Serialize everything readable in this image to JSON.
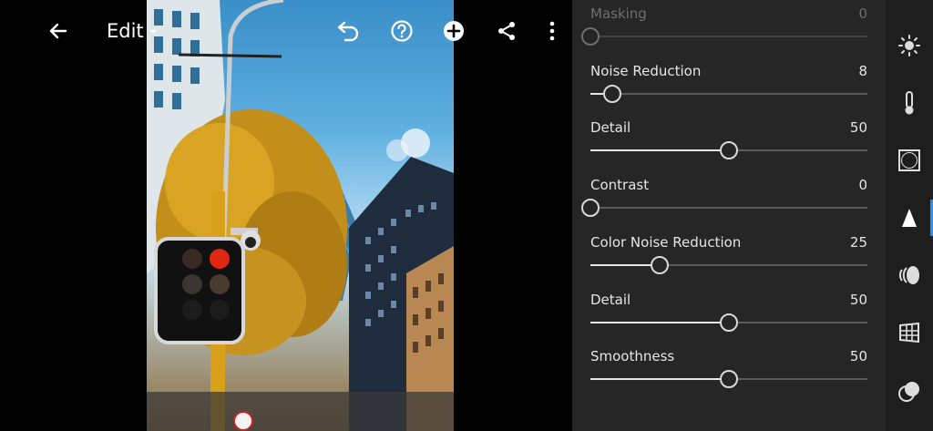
{
  "toolbar": {
    "edit_label": "Edit",
    "icons": [
      "back-arrow-icon",
      "undo-icon",
      "help-icon",
      "add-icon",
      "share-icon",
      "more-icon"
    ]
  },
  "detail_panel": {
    "sliders": [
      {
        "id": "masking",
        "label": "Masking",
        "value": "0",
        "fraction": 0.0,
        "disabled": true
      },
      {
        "id": "noise-reduction",
        "label": "Noise Reduction",
        "value": "8",
        "fraction": 0.08,
        "disabled": false
      },
      {
        "id": "detail",
        "label": "Detail",
        "value": "50",
        "fraction": 0.5,
        "disabled": false
      },
      {
        "id": "contrast",
        "label": "Contrast",
        "value": "0",
        "fraction": 0.0,
        "disabled": false
      },
      {
        "id": "color-noise-reduction",
        "label": "Color Noise Reduction",
        "value": "25",
        "fraction": 0.25,
        "disabled": false
      },
      {
        "id": "color-detail",
        "label": "Detail",
        "value": "50",
        "fraction": 0.5,
        "disabled": false
      },
      {
        "id": "smoothness",
        "label": "Smoothness",
        "value": "50",
        "fraction": 0.5,
        "disabled": false
      }
    ]
  },
  "tool_rail": {
    "items": [
      "light-icon",
      "color-temperature-icon",
      "effects-icon",
      "detail-icon",
      "optics-icon",
      "geometry-icon",
      "presets-icon"
    ],
    "active": "detail-icon",
    "accent_color": "#2e8fe8"
  },
  "colors": {
    "panel_bg": "#262626",
    "rail_bg": "#1e1e1e",
    "slider_fill": "#e6e6e6",
    "slider_track": "#5a5a5a"
  }
}
